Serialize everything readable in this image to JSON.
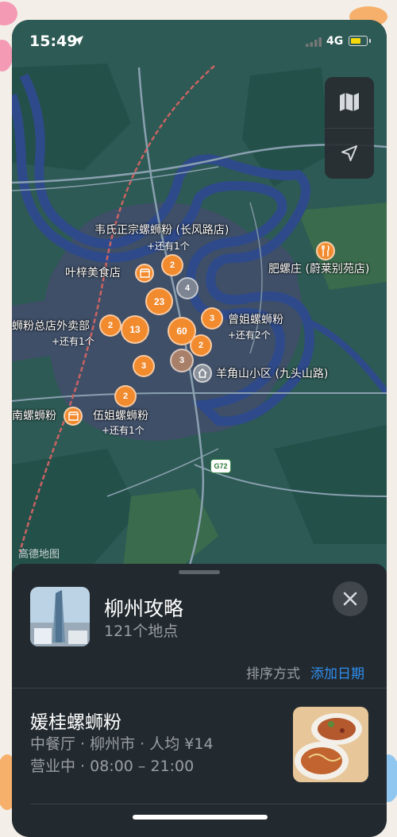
{
  "status": {
    "time": "15:49",
    "network": "4G"
  },
  "map": {
    "road_shield": "G72",
    "watermark": "高德地图",
    "clusters": [
      {
        "count": "2"
      },
      {
        "count": "4"
      },
      {
        "count": "23"
      },
      {
        "count": "2"
      },
      {
        "count": "13"
      },
      {
        "count": "60"
      },
      {
        "count": "3"
      },
      {
        "count": "2"
      },
      {
        "count": "3"
      },
      {
        "count": "3"
      },
      {
        "count": "2"
      }
    ],
    "labels": {
      "weishi": "韦氏正宗螺蛳粉 (长风路店)",
      "weishi_more": "+还有1个",
      "feiluo": "肥螺庄 (蔚莱别苑店)",
      "yezimei": "叶梓美食店",
      "zongdian": "蛳粉总店外卖部",
      "zongdian_more": "+还有1个",
      "zengjie": "曾姐螺蛳粉",
      "zengjie_more": "+还有2个",
      "yangjiao": "羊角山小区 (九头山路)",
      "nanluo": "南螺蛳粉",
      "wujie": "伍姐螺蛳粉",
      "wujie_more": "+还有1个"
    }
  },
  "sheet": {
    "guide_title": "柳州攻略",
    "guide_count": "121个地点",
    "sort_label": "排序方式",
    "sort_value": "添加日期",
    "place": {
      "name": "媛桂螺蛳粉",
      "meta": "中餐厅 · 柳州市 · 人均 ¥14",
      "hours": "营业中 · 08:00 – 21:00"
    }
  },
  "colors": {
    "accent": "#2f8ef0",
    "cluster": "#f28a2e",
    "sheet_bg": "#232a2f"
  }
}
